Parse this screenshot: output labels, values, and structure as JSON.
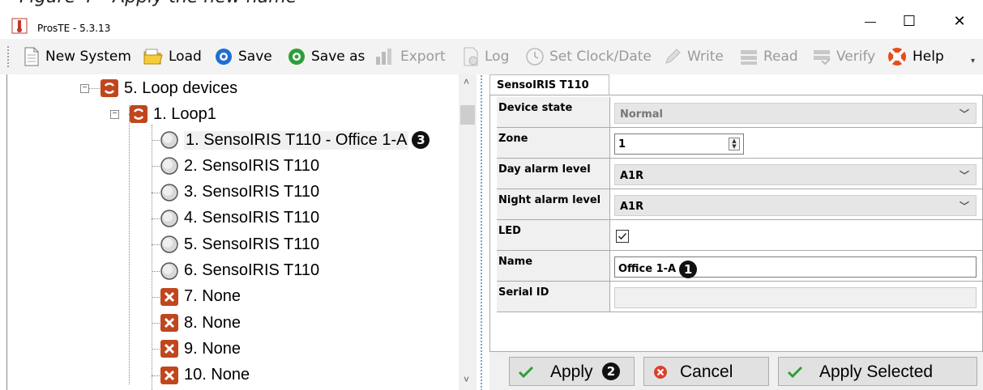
{
  "window": {
    "title": "ProsTE - 5.3.13",
    "minimize_glyph": "—",
    "maximize_glyph": "☐",
    "close_glyph": "✕"
  },
  "top_strip_text": "Figure 4 – Apply the new name",
  "toolbar": {
    "items": [
      {
        "label": "New System",
        "icon": "new-document-icon",
        "enabled": true
      },
      {
        "label": "Load",
        "icon": "folder-icon",
        "enabled": true
      },
      {
        "label": "Save",
        "icon": "save-disc-blue-icon",
        "enabled": true
      },
      {
        "label": "Save as",
        "icon": "save-disc-green-icon",
        "enabled": true
      },
      {
        "label": "Export",
        "icon": "bar-chart-icon",
        "enabled": false
      },
      {
        "label": "Log",
        "icon": "log-icon",
        "enabled": false
      },
      {
        "label": "Set Clock/Date",
        "icon": "clock-icon",
        "enabled": false
      },
      {
        "label": "Write",
        "icon": "pencil-icon",
        "enabled": false
      },
      {
        "label": "Read",
        "icon": "read-icon",
        "enabled": false
      },
      {
        "label": "Verify",
        "icon": "verify-icon",
        "enabled": false
      },
      {
        "label": "Help",
        "icon": "lifebuoy-icon",
        "enabled": true
      }
    ],
    "more_glyph": "▾"
  },
  "tree": {
    "root": "5. Loop devices",
    "loop": "1. Loop1",
    "devices": [
      {
        "label": "1. SensoIRIS  T110 - Office 1-A",
        "type": "sensor",
        "selected": true
      },
      {
        "label": "2. SensoIRIS  T110",
        "type": "sensor"
      },
      {
        "label": "3. SensoIRIS  T110",
        "type": "sensor"
      },
      {
        "label": "4. SensoIRIS  T110",
        "type": "sensor"
      },
      {
        "label": "5. SensoIRIS  T110",
        "type": "sensor"
      },
      {
        "label": "6. SensoIRIS  T110",
        "type": "sensor"
      },
      {
        "label": "7. None",
        "type": "none"
      },
      {
        "label": "8. None",
        "type": "none"
      },
      {
        "label": "9. None",
        "type": "none"
      },
      {
        "label": "10. None",
        "type": "none"
      }
    ],
    "callout": "3"
  },
  "properties": {
    "tab": "SensoIRIS  T110",
    "device_state": {
      "label": "Device state",
      "value": "Normal"
    },
    "zone": {
      "label": "Zone",
      "value": "1"
    },
    "day_alarm": {
      "label": "Day alarm level",
      "value": "A1R"
    },
    "night_alarm": {
      "label": "Night alarm level",
      "value": "A1R"
    },
    "led": {
      "label": "LED",
      "checked": true
    },
    "name": {
      "label": "Name",
      "value": "Office 1-A",
      "callout": "1"
    },
    "serial": {
      "label": "Serial ID",
      "value": ""
    }
  },
  "buttons": {
    "apply": "Apply",
    "apply_callout": "2",
    "cancel": "Cancel",
    "apply_selected": "Apply Selected"
  }
}
